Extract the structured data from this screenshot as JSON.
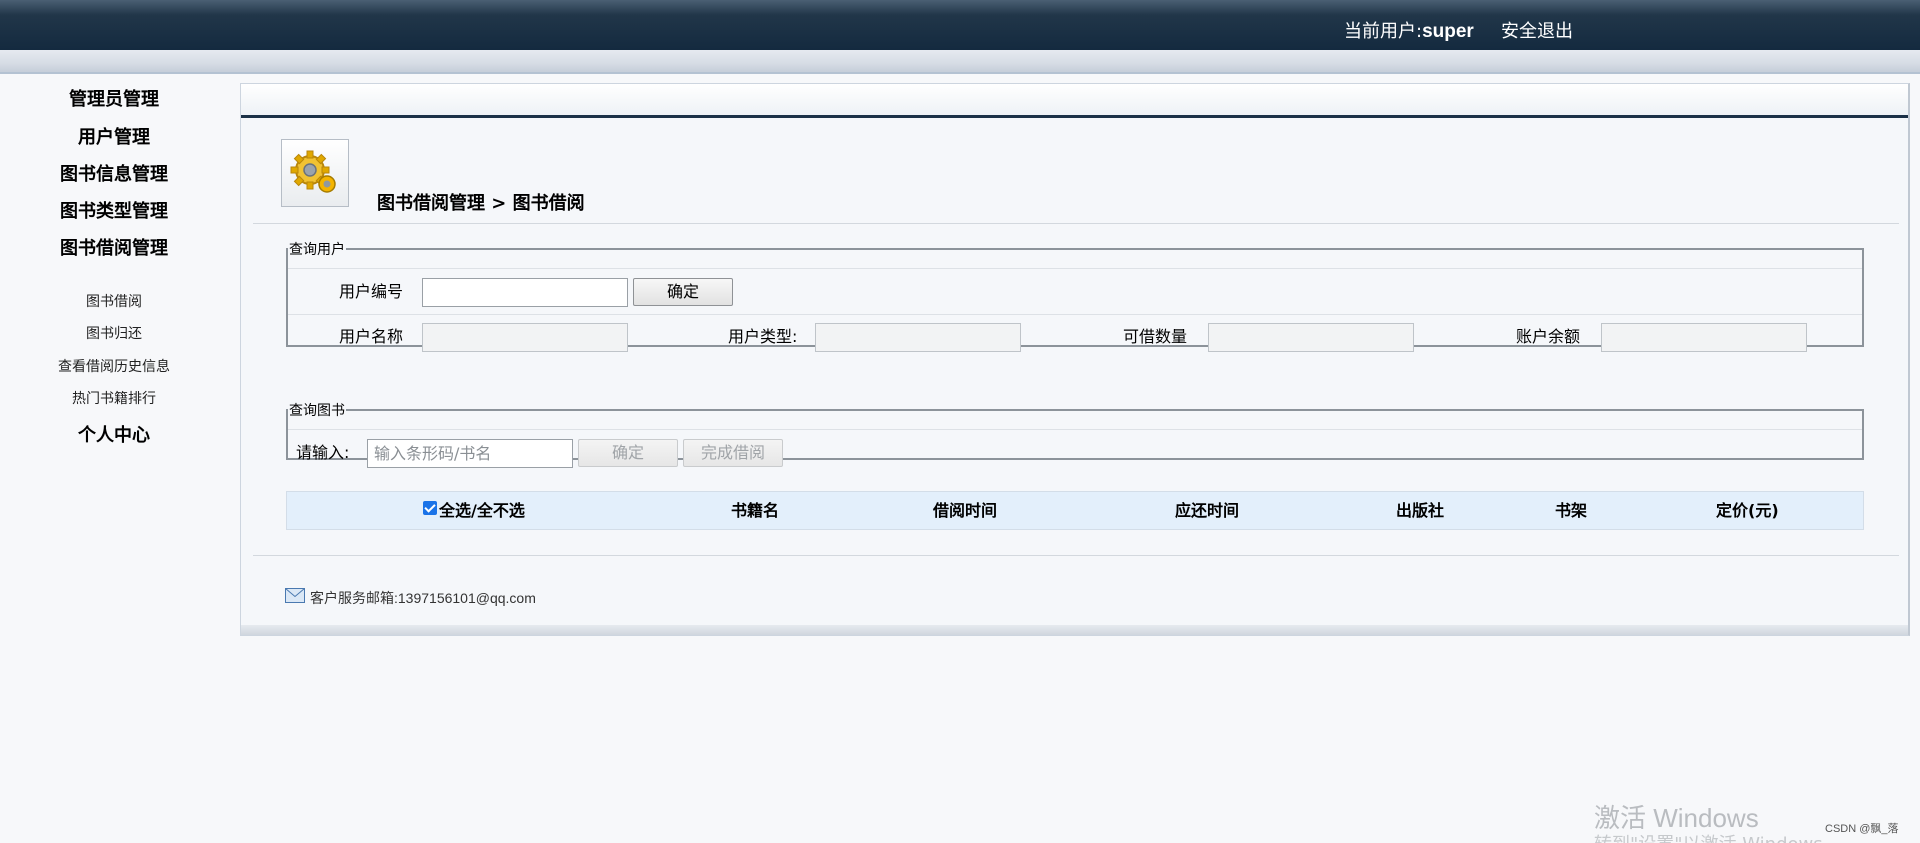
{
  "header": {
    "current_user_label": "当前用户:",
    "username": "super",
    "logout": "安全退出"
  },
  "sidebar": {
    "main_items": [
      "管理员管理",
      "用户管理",
      "图书信息管理",
      "图书类型管理",
      "图书借阅管理"
    ],
    "sub_items": [
      "图书借阅",
      "图书归还",
      "查看借阅历史信息",
      "热门书籍排行"
    ],
    "personal": "个人中心"
  },
  "main": {
    "breadcrumb": "图书借阅管理 > 图书借阅",
    "query_user": {
      "legend": "查询用户",
      "user_id_label": "用户编号",
      "confirm": "确定",
      "user_name_label": "用户名称",
      "user_type_label": "用户类型:",
      "borrow_count_label": "可借数量",
      "balance_label": "账户余额"
    },
    "query_book": {
      "legend": "查询图书",
      "input_label": "请输入:",
      "placeholder": "输入条形码/书名",
      "confirm": "确定",
      "finish": "完成借阅"
    },
    "table": {
      "select_all": "全选/全不选",
      "columns": [
        "书籍名",
        "借阅时间",
        "应还时间",
        "出版社",
        "书架",
        "定价(元)"
      ]
    },
    "footer": {
      "label": "客户服务邮箱:",
      "email": "1397156101@qq.com"
    }
  },
  "overlay": {
    "watermark_title": "激活 Windows",
    "watermark_sub": "转到\"设置\"以激活 Windows。",
    "csdn": "CSDN @飘_落"
  }
}
